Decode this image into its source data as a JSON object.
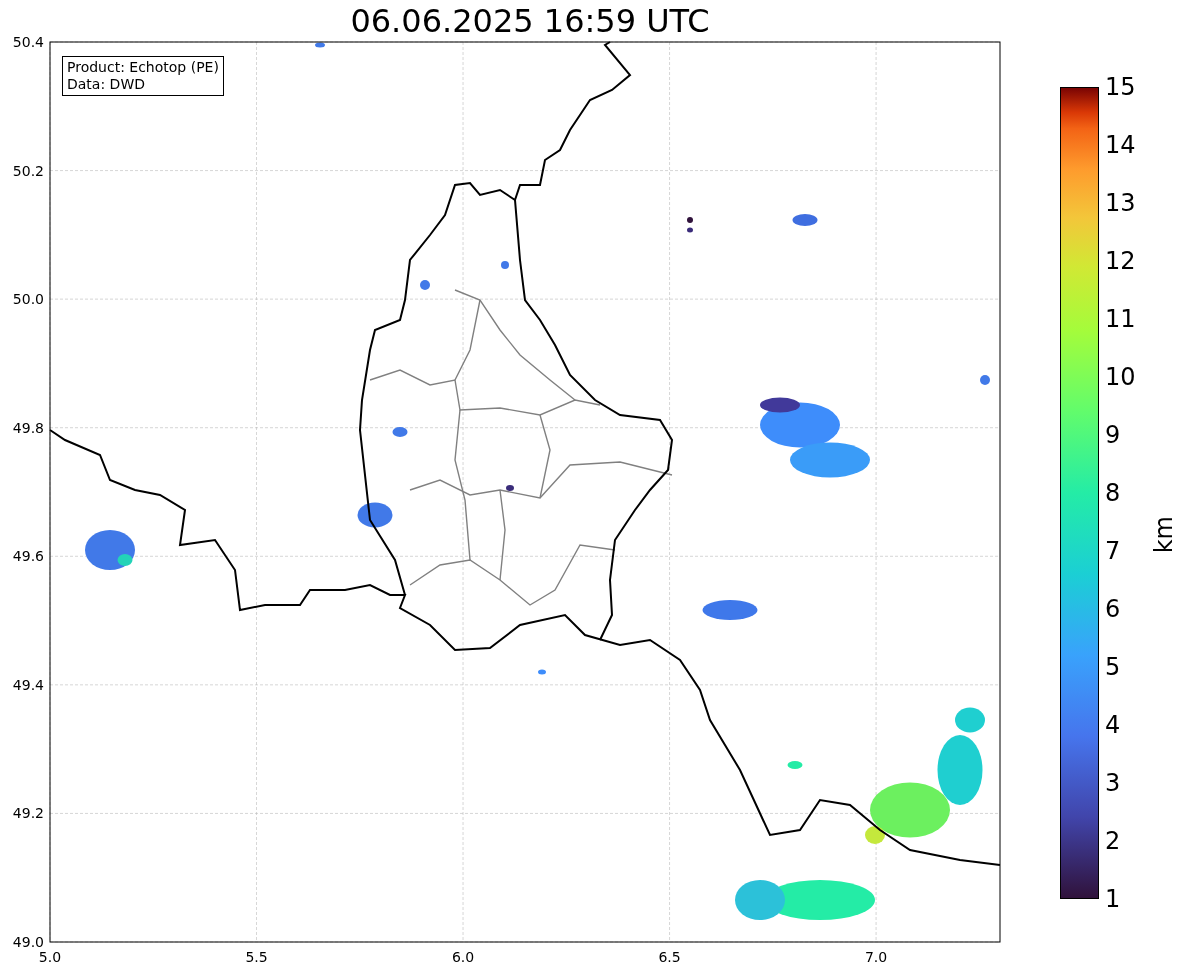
{
  "title": "06.06.2025 16:59 UTC",
  "map": {
    "info_lines": [
      "Product: Echotop (PE)",
      "Data: DWD"
    ],
    "xticks": [
      "5.0",
      "5.5",
      "6.0",
      "6.5",
      "7.0"
    ],
    "yticks": [
      "50.4",
      "50.2",
      "50.0",
      "49.8",
      "49.6",
      "49.4",
      "49.2",
      "49.0"
    ]
  },
  "colorbar": {
    "label": "km",
    "ticks": [
      "15",
      "14",
      "13",
      "12",
      "11",
      "10",
      "9",
      "8",
      "7",
      "6",
      "5",
      "4",
      "3",
      "2",
      "1"
    ]
  }
}
